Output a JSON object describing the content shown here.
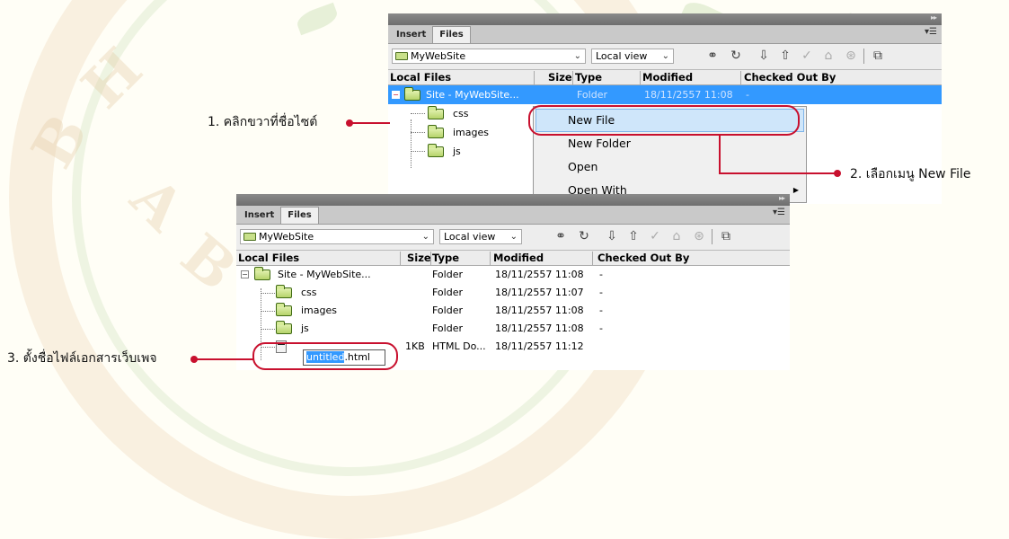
{
  "top_panel": {
    "tabs": [
      {
        "label": "Insert",
        "active": false
      },
      {
        "label": "Files",
        "active": true
      }
    ],
    "site_select": "MyWebSite",
    "view_select": "Local view",
    "columns": [
      "Local Files",
      "Size",
      "Type",
      "Modified",
      "Checked Out By"
    ],
    "rows": [
      {
        "name": "Site - MyWebSite...",
        "size": "",
        "type": "Folder",
        "modified": "18/11/2557 11:08",
        "checked_out": "-",
        "selected": true
      },
      {
        "name": "css"
      },
      {
        "name": "images"
      },
      {
        "name": "js"
      }
    ],
    "context_menu": [
      "New File",
      "New Folder",
      "Open",
      "Open With"
    ]
  },
  "bottom_panel": {
    "tabs": [
      {
        "label": "Insert",
        "active": false
      },
      {
        "label": "Files",
        "active": true
      }
    ],
    "site_select": "MyWebSite",
    "view_select": "Local view",
    "columns": [
      "Local Files",
      "Size",
      "Type",
      "Modified",
      "Checked Out By"
    ],
    "rows": [
      {
        "name": "Site - MyWebSite...",
        "size": "",
        "type": "Folder",
        "modified": "18/11/2557 11:08",
        "checked_out": "-"
      },
      {
        "name": "css",
        "size": "",
        "type": "Folder",
        "modified": "18/11/2557 11:07",
        "checked_out": "-"
      },
      {
        "name": "images",
        "size": "",
        "type": "Folder",
        "modified": "18/11/2557 11:08",
        "checked_out": "-"
      },
      {
        "name": "js",
        "size": "",
        "type": "Folder",
        "modified": "18/11/2557 11:08",
        "checked_out": "-"
      },
      {
        "name_selected": "untitled",
        "name_ext": ".html",
        "size": "1KB",
        "type": "HTML Do...",
        "modified": "18/11/2557 11:12",
        "checked_out": ""
      }
    ]
  },
  "callouts": {
    "step1": "1. คลิกขวาที่ชื่อไซต์",
    "step2": "2. เลือกเมนู New File",
    "step3": "3. ตั้งชื่อไฟล์เอกสารเว็บเพจ"
  },
  "icons": {
    "toolbar": [
      "connect-icon",
      "refresh-icon",
      "get-files-icon",
      "put-files-icon",
      "check-out-icon",
      "check-in-icon",
      "synchronize-icon",
      "expand-icon"
    ]
  },
  "colors": {
    "annotation_red": "#c8102e",
    "selection_blue": "#3399ff"
  }
}
